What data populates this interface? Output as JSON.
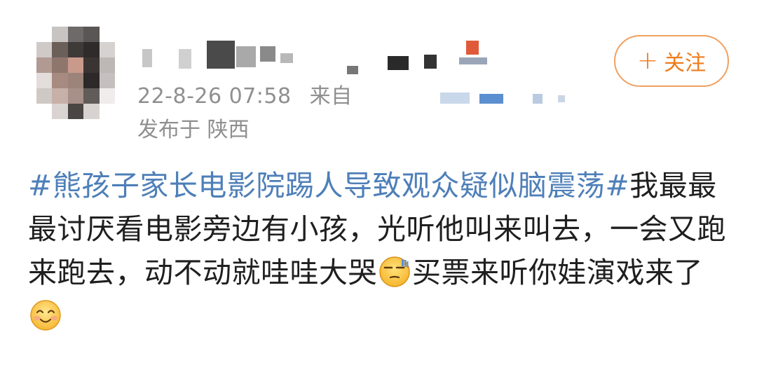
{
  "post": {
    "author_name": "",
    "timestamp": "22-8-26 07:58",
    "source_prefix": "来自",
    "location": "发布于 陕西",
    "follow_button_plus": "+",
    "follow_button_label": "关注",
    "topic": "#熊孩子家长电影院踢人导致观众疑似脑震荡#",
    "text_part1": "我最最最讨厌看电影旁边有小孩，光听他叫来叫去，一会又跑来跑去，动不动就哇哇大哭",
    "emoji1": "sweat-smirk-emoji",
    "text_part2": "买票来听你娃演戏来了",
    "emoji2": "smile-emoji"
  },
  "colors": {
    "topic": "#4e7fb8",
    "follow_accent": "#f07b1c",
    "meta_gray": "#8f8f8f",
    "body_text": "#1f1f1f"
  }
}
